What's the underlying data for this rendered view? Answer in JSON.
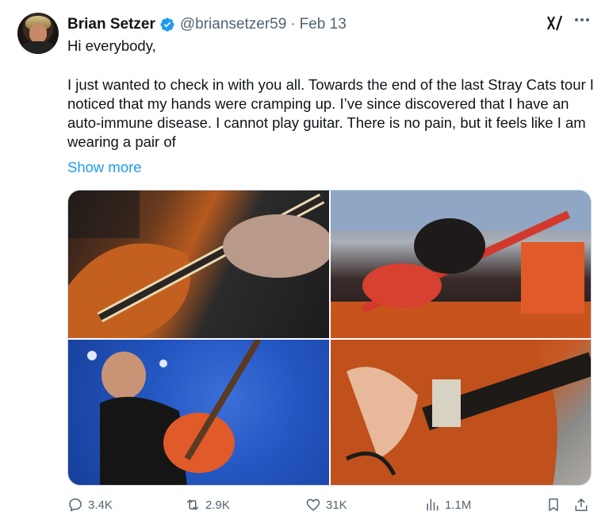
{
  "tweet": {
    "author_name": "Brian Setzer",
    "handle": "@briansetzer59",
    "separator": "·",
    "date": "Feb 13",
    "text_line1": "Hi everybody,",
    "text_body": "I just wanted to check in with you all. Towards the end of the last Stray Cats tour I noticed that my hands were cramping up. I’ve since discovered that I have an auto-immune disease. I cannot play guitar. There is no pain, but it feels like I am wearing a pair of",
    "show_more": "Show more",
    "verified": true,
    "media": [
      {
        "description": "close-up of hands playing orange guitar"
      },
      {
        "description": "guitarist kneeling on stage with red guitar"
      },
      {
        "description": "guitarist performing under blue stage light"
      },
      {
        "description": "hand strumming orange hollow-body guitar"
      }
    ]
  },
  "actions": {
    "replies": "3.4K",
    "reposts": "2.9K",
    "likes": "31K",
    "views": "1.1M"
  },
  "colors": {
    "accent": "#1d9bf0",
    "muted": "#536471",
    "text": "#0f1419"
  }
}
